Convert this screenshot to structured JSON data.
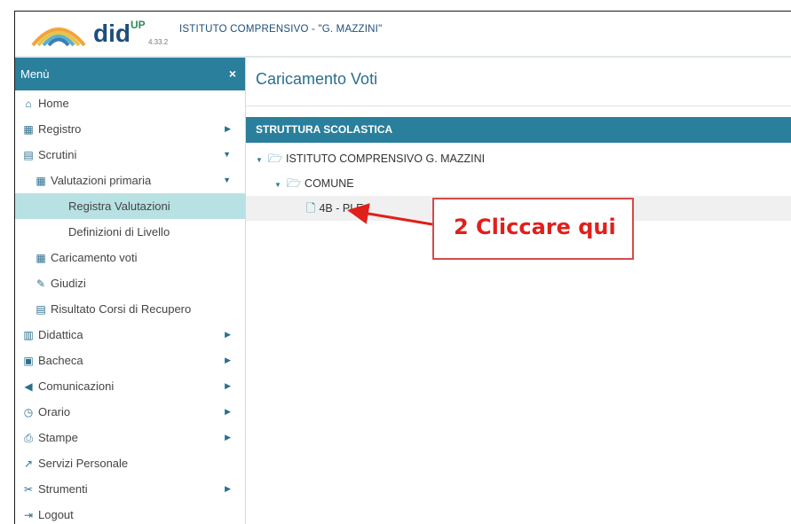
{
  "header": {
    "brand": "did",
    "brand_sup": "UP",
    "version": "4.33.2",
    "school": "ISTITUTO COMPRENSIVO - \"G. MAZZINI\""
  },
  "sidebar": {
    "title": "Menù",
    "close_icon": "×",
    "items": [
      {
        "label": "Home",
        "icon": "home-icon"
      },
      {
        "label": "Registro",
        "icon": "calendar-icon"
      },
      {
        "label": "Scrutini",
        "icon": "document-icon"
      },
      {
        "label": "Valutazioni primaria",
        "icon": "grid-icon"
      },
      {
        "label": "Registra Valutazioni"
      },
      {
        "label": "Definizioni di Livello"
      },
      {
        "label": "Caricamento voti",
        "icon": "grid-icon"
      },
      {
        "label": "Giudizi",
        "icon": "edit-icon"
      },
      {
        "label": "Risultato Corsi di Recupero",
        "icon": "document-icon"
      },
      {
        "label": "Didattica",
        "icon": "book-icon"
      },
      {
        "label": "Bacheca",
        "icon": "board-icon"
      },
      {
        "label": "Comunicazioni",
        "icon": "megaphone-icon"
      },
      {
        "label": "Orario",
        "icon": "clock-icon"
      },
      {
        "label": "Stampe",
        "icon": "printer-icon"
      },
      {
        "label": "Servizi Personale",
        "icon": "share-icon"
      },
      {
        "label": "Strumenti",
        "icon": "tools-icon"
      },
      {
        "label": "Logout",
        "icon": "logout-icon"
      }
    ]
  },
  "main": {
    "title": "Caricamento Voti",
    "section": "STRUTTURA SCOLASTICA",
    "tree": {
      "root": "ISTITUTO COMPRENSIVO G. MAZZINI",
      "child": "COMUNE",
      "leaf": "4B - PLE"
    }
  },
  "callout": {
    "text": "2 Cliccare qui",
    "color": "#e0201b"
  },
  "colors": {
    "accent": "#2a7f9c",
    "active_item": "#b8e1e3"
  }
}
